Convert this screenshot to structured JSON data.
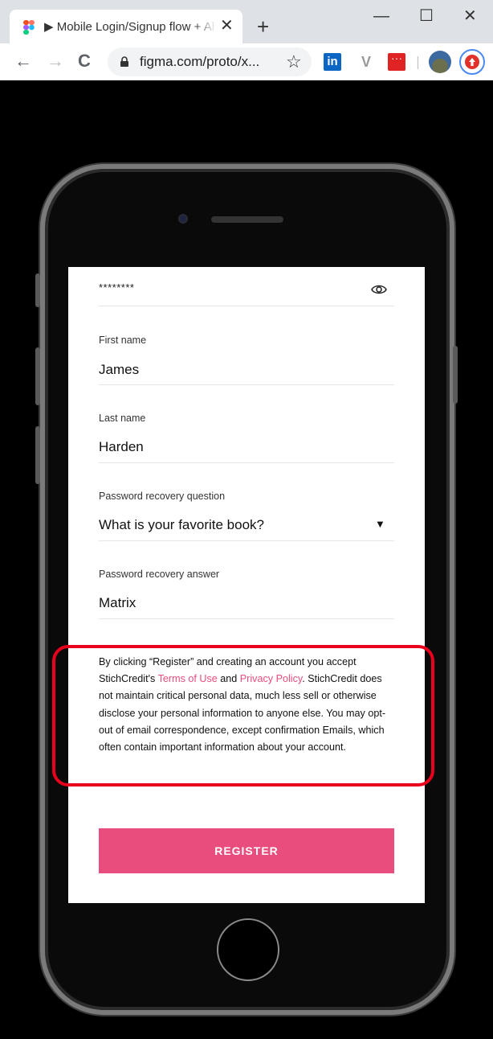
{
  "browser": {
    "tab_title": "▶ Mobile Login/Signup flow + Al",
    "tab_close": "✕",
    "new_tab": "+",
    "minimize": "—",
    "maximize": "☐",
    "close": "✕",
    "back": "←",
    "forward": "→",
    "reload": "C",
    "url": "figma.com/proto/x...",
    "bookmark": "☆",
    "ext_linkedin": "in",
    "ext_v": "V"
  },
  "form": {
    "password_mask": "********",
    "first_name": {
      "label": "First name",
      "value": "James"
    },
    "last_name": {
      "label": "Last name",
      "value": "Harden"
    },
    "recovery_question": {
      "label": "Password recovery question",
      "value": "What is your favorite book?",
      "arrow": "▼"
    },
    "recovery_answer": {
      "label": "Password recovery answer",
      "value": "Matrix"
    }
  },
  "legal": {
    "part1": "By clicking “Register” and creating an account you accept StichCredit's ",
    "terms": "Terms of Use",
    "and": " and ",
    "privacy": "Privacy Policy",
    "part2": ". StichCredit does not maintain critical personal data, much less sell or otherwise disclose your personal information to anyone else. You may opt-out of email correspondence, except confirmation Emails, which often contain important information about your account."
  },
  "register_label": "REGISTER",
  "colors": {
    "accent": "#e84d7d",
    "highlight": "#e8001c"
  }
}
